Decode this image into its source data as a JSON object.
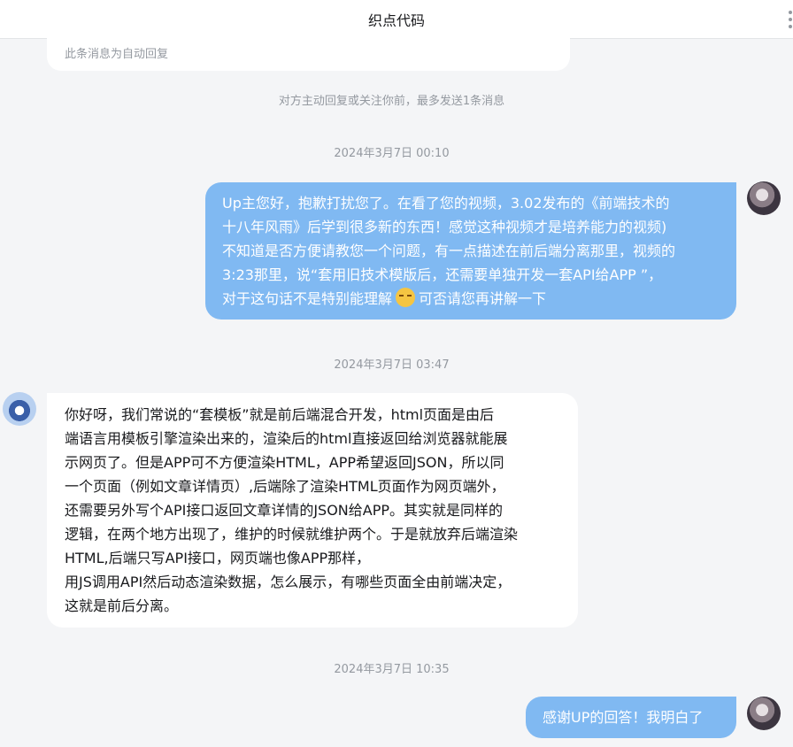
{
  "header": {
    "title": "织点代码"
  },
  "icons": {
    "more": "more-vertical-icon",
    "emoji": "crying-laugh-emoji-icon"
  },
  "colors": {
    "outgoing_bubble": "#80b9f2",
    "incoming_bubble": "#ffffff",
    "background": "#f4f5f7"
  },
  "conversation": {
    "previous_message_note": "此条消息为自动回复",
    "system_notice": "对方主动回复或关注你前，最多发送1条消息",
    "timestamps": [
      "2024年3月7日 00:10",
      "2024年3月7日 03:47",
      "2024年3月7日 10:35"
    ],
    "messages": [
      {
        "sender": "self",
        "lines": [
          "Up主您好，抱歉打扰您了。在看了您的视频，3.02发布的《前端技术的",
          "十八年风雨》后学到很多新的东西！感觉这种视频才是培养能力的视频)",
          "不知道是否方便请教您一个问题，有一点描述在前后端分离那里，视频的",
          "3:23那里，说“套用旧技术模版后，还需要单独开发一套API给APP ”，"
        ],
        "last_line_before_emoji": "对于这句话不是特别能理解",
        "last_line_after_emoji": "可否请您再讲解一下"
      },
      {
        "sender": "up",
        "lines": [
          "你好呀，我们常说的“套模板”就是前后端混合开发，html页面是由后",
          "端语言用模板引擎渲染出来的，渲染后的html直接返回给浏览器就能展",
          "示网页了。但是APP可不方便渲染HTML，APP希望返回JSON，所以同",
          "一个页面（例如文章详情页）,后端除了渲染HTML页面作为网页端外，",
          "还需要另外写个API接口返回文章详情的JSON给APP。其实就是同样的",
          "逻辑，在两个地方出现了，维护的时候就维护两个。于是就放弃后端渲染",
          "HTML,后端只写API接口，网页端也像APP那样，",
          "用JS调用API然后动态渲染数据，怎么展示，有哪些页面全由前端决定，",
          "这就是前后分离。"
        ]
      },
      {
        "sender": "self",
        "text": "感谢UP的回答！我明白了"
      }
    ]
  }
}
